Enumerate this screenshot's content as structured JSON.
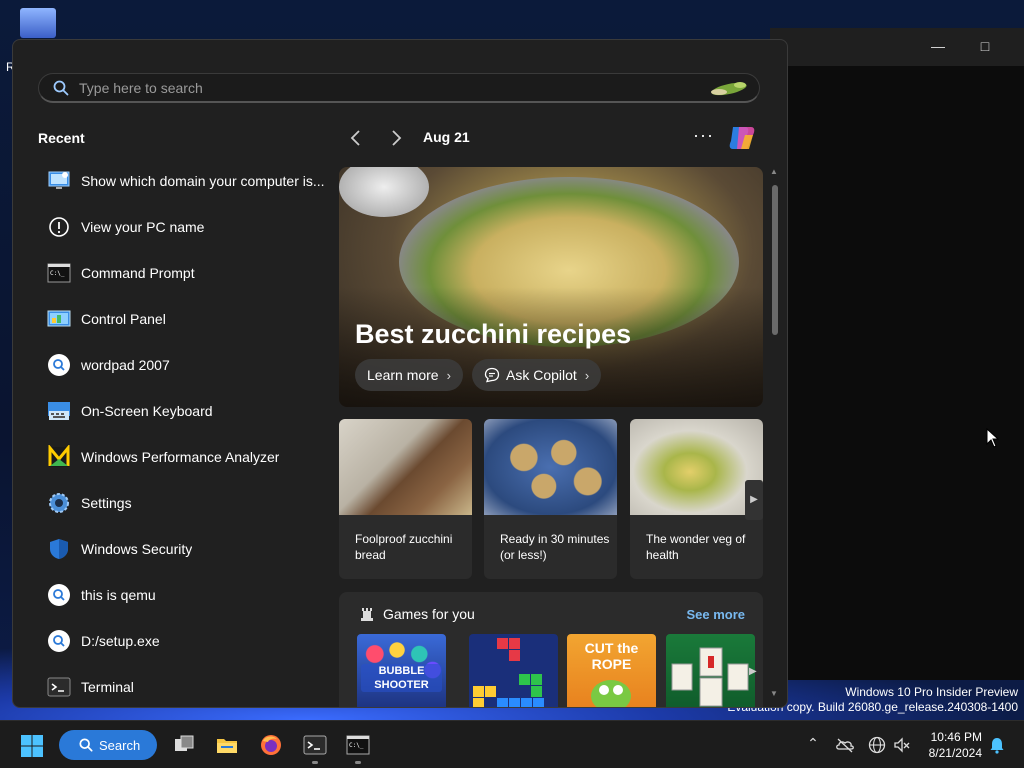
{
  "desktop": {
    "icon_label": "R",
    "watermark_line1": "Windows 10 Pro Insider Preview",
    "watermark_line2": "Evaluation copy. Build 26080.ge_release.240308-1400"
  },
  "bg_window": {
    "minimize": "—",
    "maximize": "□"
  },
  "search": {
    "placeholder": "Type here to search"
  },
  "recent": {
    "title": "Recent",
    "items": [
      {
        "label": "Show which domain your computer is...",
        "icon": "monitor-icon"
      },
      {
        "label": "View your PC name",
        "icon": "info-icon"
      },
      {
        "label": "Command Prompt",
        "icon": "cmd-icon"
      },
      {
        "label": "Control Panel",
        "icon": "control-panel-icon"
      },
      {
        "label": "wordpad 2007",
        "icon": "web-search-icon"
      },
      {
        "label": "On-Screen Keyboard",
        "icon": "keyboard-icon"
      },
      {
        "label": "Windows Performance Analyzer",
        "icon": "wpa-icon"
      },
      {
        "label": "Settings",
        "icon": "gear-icon"
      },
      {
        "label": "Windows Security",
        "icon": "shield-icon"
      },
      {
        "label": "this is qemu",
        "icon": "web-search-icon"
      },
      {
        "label": "D:/setup.exe",
        "icon": "web-search-icon"
      },
      {
        "label": "Terminal",
        "icon": "terminal-icon"
      }
    ]
  },
  "feed": {
    "date": "Aug 21",
    "more": "···",
    "hero": {
      "title": "Best zucchini recipes",
      "learn_more": "Learn more",
      "ask_copilot": "Ask Copilot"
    },
    "cards": [
      {
        "caption": "Foolproof zucchini bread"
      },
      {
        "caption": "Ready in 30 minutes (or less!)"
      },
      {
        "caption": "The wonder veg of health"
      }
    ],
    "games": {
      "title": "Games for you",
      "see_more": "See more",
      "tiles": [
        {
          "name": "BUBBLE SHOOTER"
        },
        {
          "name": "tetris"
        },
        {
          "name": "CUT the ROPE"
        },
        {
          "name": "mahjong"
        }
      ]
    }
  },
  "taskbar": {
    "search_label": "Search",
    "time": "10:46 PM",
    "date": "8/21/2024"
  },
  "colors": {
    "accent": "#2a79d8",
    "link": "#78b9f0",
    "menu_bg": "#202020"
  }
}
